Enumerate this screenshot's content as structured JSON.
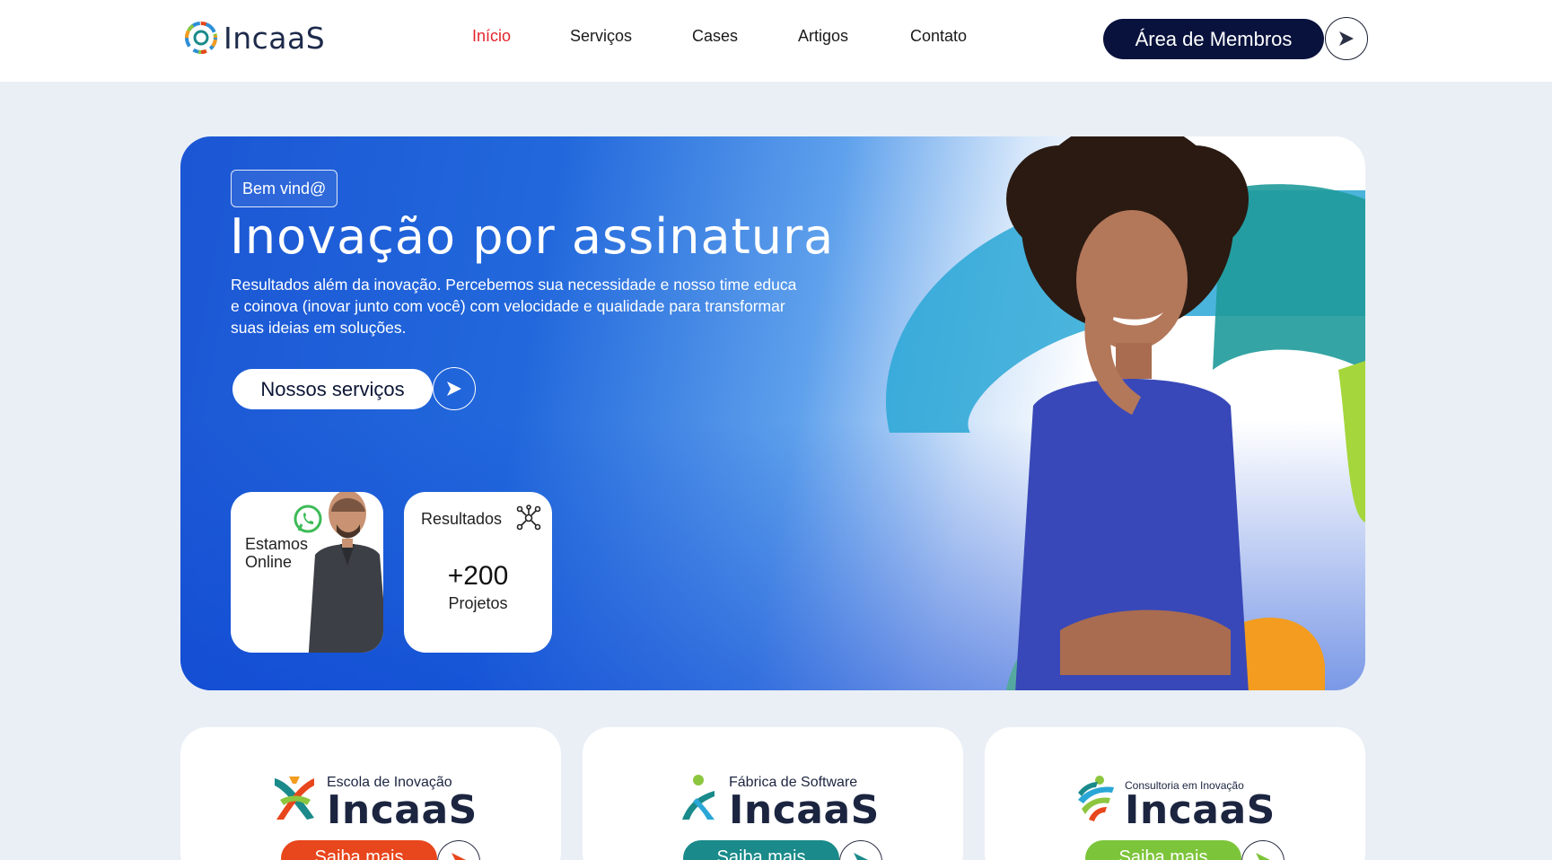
{
  "header": {
    "logo_text": "IncaaS",
    "nav": [
      {
        "label": "Início",
        "active": true
      },
      {
        "label": "Serviços",
        "active": false
      },
      {
        "label": "Cases",
        "active": false
      },
      {
        "label": "Artigos",
        "active": false
      },
      {
        "label": "Contato",
        "active": false
      }
    ],
    "members_label": "Área de Membros",
    "active_color": "#e3252c"
  },
  "hero": {
    "badge": "Bem vind@",
    "title": "Inovação por assinatura",
    "description": "Resultados além da inovação. Percebemos sua necessidade e nosso time educa e coinova (inovar junto com você) com velocidade e qualidade para transformar suas ideias em soluções.",
    "cta_label": "Nossos serviços",
    "online_card": {
      "label_line1": "Estamos",
      "label_line2": "Online",
      "icon": "whatsapp-icon"
    },
    "results_card": {
      "title": "Resultados",
      "count": "+200",
      "unit": "Projetos",
      "icon": "network-icon"
    }
  },
  "services": [
    {
      "subtitle": "Escola de Inovação",
      "name": "IncaaS",
      "button": "Saiba mais",
      "color": "#e8461c"
    },
    {
      "subtitle": "Fábrica de Software",
      "name": "IncaaS",
      "button": "Saiba mais",
      "color": "#1a8a8a"
    },
    {
      "subtitle": "Consultoria em Inovação",
      "name": "IncaaS",
      "button": "Saiba mais",
      "color": "#7cc53a"
    }
  ],
  "colors": {
    "navy": "#08123d",
    "hero_blue": "#1b56d4",
    "page_bg": "#eaeff6"
  }
}
